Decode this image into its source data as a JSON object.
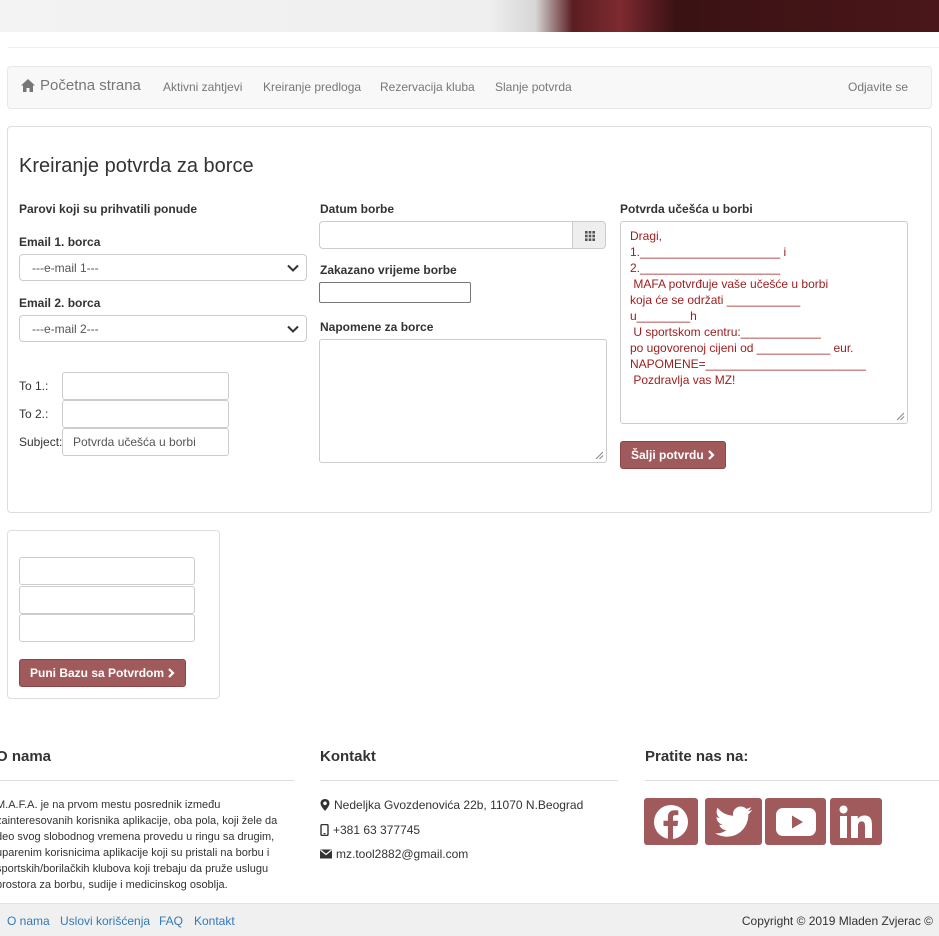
{
  "nav": {
    "brand": "Početna strana",
    "links": [
      "Aktivni zahtjevi",
      "Kreiranje predloga",
      "Rezervacija kluba",
      "Slanje potvrda"
    ],
    "logout": "Odjavite se"
  },
  "form": {
    "title": "Kreiranje potvrda za borce",
    "pairs_label": "Parovi koji su prihvatili ponude",
    "email1_label": "Email 1. borca",
    "email1_value": "---e-mail 1---",
    "email2_label": "Email 2. borca",
    "email2_value": "---e-mail 2---",
    "to1_label": "To 1.:",
    "to2_label": "To 2.:",
    "subject_label": "Subject:",
    "subject_value": "Potvrda učešća u borbi",
    "date_label": "Datum borbe",
    "time_label": "Zakazano vrijeme borbe",
    "notes_label": "Napomene za borce",
    "confirm_label": "Potvrda učešća u borbi",
    "letter": "Dragi,\n1._____________________ i\n2._____________________\n MAFA potvrđuje vaše učešće u borbi\nkoja će se održati ___________\nu________h\n U sportskom centru:____________\npo ugovorenoj cijeni od ___________ eur.\nNAPOMENE=________________________\n Pozdravlja vas MZ!",
    "send_button": "Šalji potvrdu"
  },
  "db_panel": {
    "button": "Puni Bazu sa Potvrdom"
  },
  "footer": {
    "about_title": "O nama",
    "about_lines": [
      "M.A.F.A. je na prvom mestu posrednik između",
      "zainteresovanih korisnika aplikacije, oba pola, koji žele da",
      "deo svog slobodnog vremena provedu u ringu sa drugim,",
      "uparenim korisnicima aplikacije koji su pristali na borbu i",
      "sportskih/borilačkih klubova koji trebaju da pruže uslugu",
      "prostora za borbu, sudije i medicinskog osoblja."
    ],
    "contact_title": "Kontakt",
    "address": "Nedeljka Gvozdenovića 22b, 11070 N.Beograd",
    "phone": "+381 63 377745",
    "email": "mz.tool2882@gmail.com",
    "follow_title": "Pratite nas na:",
    "social": [
      "facebook-icon",
      "twitter-icon",
      "youtube-icon",
      "linkedin-icon"
    ],
    "links": [
      "O nama",
      "Uslovi korišćenja",
      "FAQ",
      "Kontakt"
    ],
    "copyright": "Copyright © 2019 Mladen Zvjerac ©"
  },
  "colors": {
    "accent": "#a05a5c",
    "letter_text": "#9d1b1b",
    "link": "#337ab7"
  }
}
